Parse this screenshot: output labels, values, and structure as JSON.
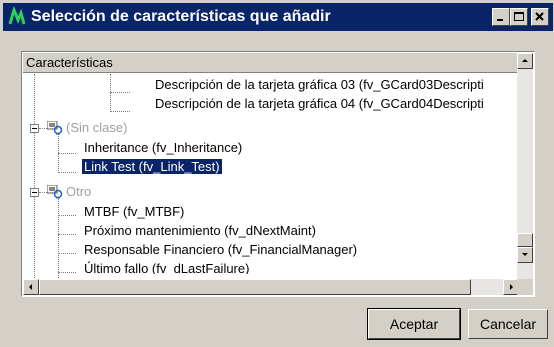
{
  "window": {
    "title": "Selección de características que añadir"
  },
  "list": {
    "header": "Características",
    "rows": [
      {
        "label": "Descripción de la tarjeta gráfica 03 (fv_GCard03Descripti"
      },
      {
        "label": "Descripción de la tarjeta gráfica 04 (fv_GCard04Descripti"
      },
      {
        "label": "(Sin clase)"
      },
      {
        "label": "Inheritance (fv_Inheritance)"
      },
      {
        "label": "Link Test (fv_Link_Test)"
      },
      {
        "label": "Otro"
      },
      {
        "label": "MTBF (fv_MTBF)"
      },
      {
        "label": "Próximo mantenimiento (fv_dNextMaint)"
      },
      {
        "label": "Responsable Financiero (fv_FinancialManager)"
      },
      {
        "label": "Último fallo (fv_dLastFailure)"
      }
    ]
  },
  "buttons": {
    "accept": "Aceptar",
    "cancel": "Cancelar"
  },
  "colors": {
    "titlebar": "#0a246a",
    "selection": "#0a246a",
    "face": "#d4d0c8"
  }
}
